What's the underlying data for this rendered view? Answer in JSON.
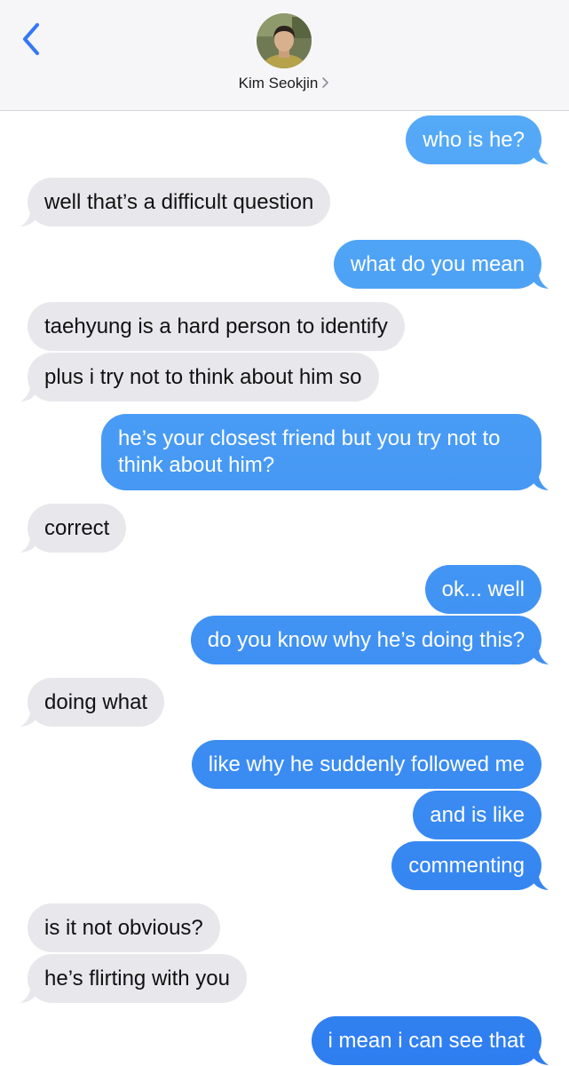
{
  "header": {
    "contact_name": "Kim Seokjin",
    "back_icon": "chevron-left-icon",
    "accent": "#3478f6"
  },
  "colors": {
    "incoming": "#e8e8ec",
    "outgoing_top": "#5aaff8",
    "outgoing_bottom": "#2f7ef0"
  },
  "messages": [
    {
      "from": "me",
      "text": "who is he?"
    },
    {
      "from": "them",
      "text": "well that’s a difficult question"
    },
    {
      "from": "me",
      "text": "what do you mean"
    },
    {
      "from": "them",
      "text": "taehyung is a hard person to identify"
    },
    {
      "from": "them",
      "text": "plus i try not to think about him so"
    },
    {
      "from": "me",
      "text": "he’s your closest friend but you try not to think about him?"
    },
    {
      "from": "them",
      "text": "correct"
    },
    {
      "from": "me",
      "text": "ok... well"
    },
    {
      "from": "me",
      "text": "do you know why he’s doing this?"
    },
    {
      "from": "them",
      "text": "doing what"
    },
    {
      "from": "me",
      "text": "like why he suddenly followed me"
    },
    {
      "from": "me",
      "text": "and is like"
    },
    {
      "from": "me",
      "text": "commenting"
    },
    {
      "from": "them",
      "text": "is it not obvious?"
    },
    {
      "from": "them",
      "text": "he’s flirting with you"
    },
    {
      "from": "me",
      "text": "i mean i can see that"
    }
  ]
}
